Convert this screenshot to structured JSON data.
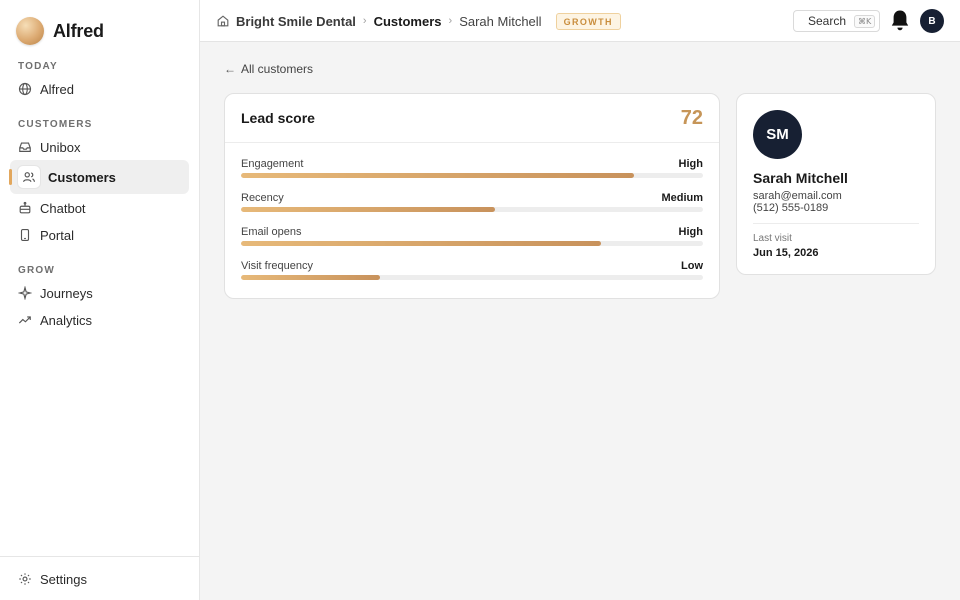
{
  "brand": {
    "name": "Alfred"
  },
  "sidebar": {
    "sections": [
      {
        "label": "TODAY",
        "items": [
          {
            "label": "Alfred",
            "icon": "globe-icon"
          }
        ]
      },
      {
        "label": "CUSTOMERS",
        "items": [
          {
            "label": "Unibox",
            "icon": "inbox-icon"
          },
          {
            "label": "Customers",
            "icon": "users-icon",
            "active": true
          },
          {
            "label": "Chatbot",
            "icon": "bot-icon"
          },
          {
            "label": "Portal",
            "icon": "phone-icon"
          }
        ]
      },
      {
        "label": "GROW",
        "items": [
          {
            "label": "Journeys",
            "icon": "sparkle-icon"
          },
          {
            "label": "Analytics",
            "icon": "trend-icon"
          }
        ]
      }
    ],
    "footer": {
      "label": "Settings",
      "icon": "gear-icon"
    }
  },
  "topbar": {
    "breadcrumb": [
      "Bright Smile Dental",
      "Customers",
      "Sarah Mitchell"
    ],
    "separator": "›",
    "plan_badge": "GROWTH",
    "search_label": "Search",
    "search_shortcut": "⌘K",
    "user_initial": "B"
  },
  "main": {
    "back_label": "All customers",
    "lead_score": {
      "title": "Lead score",
      "score": "72",
      "metrics": [
        {
          "name": "Engagement",
          "level": "High",
          "percent": 85
        },
        {
          "name": "Recency",
          "level": "Medium",
          "percent": 55
        },
        {
          "name": "Email opens",
          "level": "High",
          "percent": 78
        },
        {
          "name": "Visit frequency",
          "level": "Low",
          "percent": 30
        }
      ]
    },
    "profile": {
      "initials": "SM",
      "name": "Sarah Mitchell",
      "email": "sarah@email.com",
      "phone": "(512) 555-0189",
      "last_visit_label": "Last visit",
      "last_visit": "Jun 15, 2026"
    }
  },
  "colors": {
    "accent": "#c69558",
    "avatar_bg": "#172033",
    "badge": "#c98e3e"
  }
}
